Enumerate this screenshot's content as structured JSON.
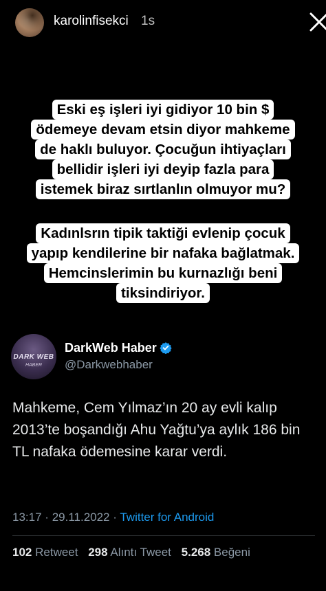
{
  "story": {
    "username": "karolinfisekci",
    "time": "1s"
  },
  "caption": {
    "paragraph1": [
      "Eski eş işleri iyi gidiyor 10 bin $",
      "ödemeye devam etsin diyor mahkeme",
      "de haklı buluyor. Çocuğun ihtiyaçları",
      "bellidir işleri iyi deyip fazla para",
      "istemek biraz sırtlanlın olmuyor mu?"
    ],
    "paragraph2": [
      "Kadınlsrın tipik taktiği evlenip çocuk",
      "yapıp kendilerine bir nafaka bağlatmak.",
      "Hemcinslerimin bu kurnazlığı beni",
      "tiksindiriyor."
    ]
  },
  "tweet": {
    "name": "DarkWeb Haber",
    "handle": "@Darkwebhaber",
    "avatar_text_1": "DARK WEB",
    "avatar_text_2": "HABER",
    "text": "Mahkeme, Cem Yılmaz’ın 20 ay evli kalıp 2013’te boşandığı Ahu Yağtu’ya aylık 186 bin TL nafaka ödemesine karar verdi.",
    "time": "13:17",
    "date": "29.11.2022",
    "separator": "·",
    "source": "Twitter for Android",
    "retweets": "102",
    "retweets_label": "Retweet",
    "quotes": "298",
    "quotes_label": "Alıntı Tweet",
    "likes": "5.268",
    "likes_label": "Beğeni"
  },
  "colors": {
    "background": "#000000",
    "link": "#1d9bf0",
    "muted": "#8b98a5",
    "verified": "#1d9bf0"
  },
  "icons": {
    "close": "close-icon",
    "verified": "verified-badge-icon"
  }
}
